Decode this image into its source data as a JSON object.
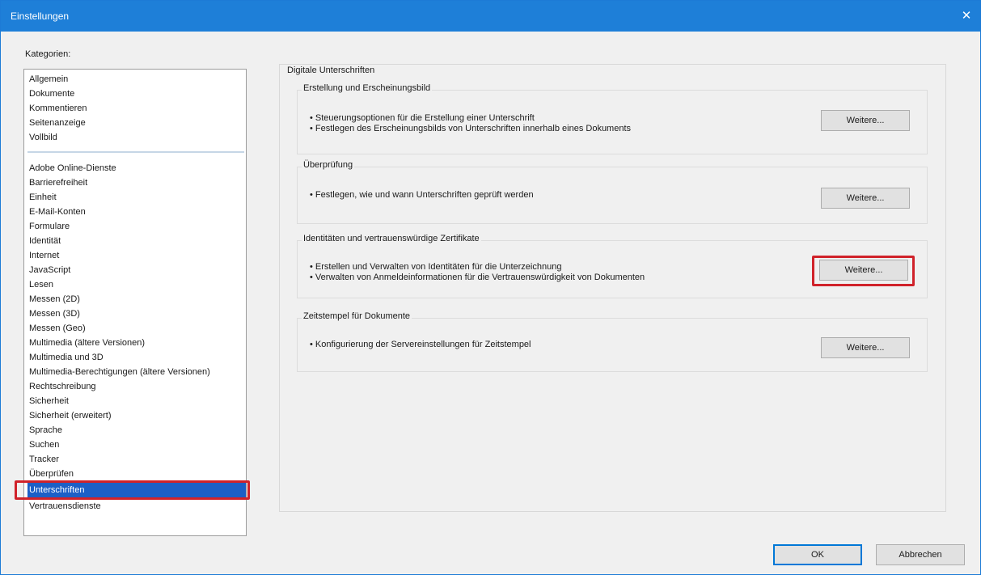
{
  "window": {
    "title": "Einstellungen",
    "close_glyph": "✕"
  },
  "categories": {
    "label": "Kategorien:",
    "group1": [
      "Allgemein",
      "Dokumente",
      "Kommentieren",
      "Seitenanzeige",
      "Vollbild"
    ],
    "group2": [
      "Adobe Online-Dienste",
      "Barrierefreiheit",
      "Einheit",
      "E-Mail-Konten",
      "Formulare",
      "Identität",
      "Internet",
      "JavaScript",
      "Lesen",
      "Messen (2D)",
      "Messen (3D)",
      "Messen (Geo)",
      "Multimedia (ältere Versionen)",
      "Multimedia und 3D",
      "Multimedia-Berechtigungen (ältere Versionen)",
      "Rechtschreibung",
      "Sicherheit",
      "Sicherheit (erweitert)",
      "Sprache",
      "Suchen",
      "Tracker",
      "Überprüfen",
      "Unterschriften",
      "Vertrauensdienste"
    ],
    "selected": "Unterschriften"
  },
  "main": {
    "title": "Digitale Unterschriften",
    "sections": [
      {
        "title": "Erstellung und Erscheinungsbild",
        "bullets": [
          "• Steuerungsoptionen für die Erstellung einer Unterschrift",
          "• Festlegen des Erscheinungsbilds von Unterschriften innerhalb eines Dokuments"
        ],
        "button": "Weitere..."
      },
      {
        "title": "Überprüfung",
        "bullets": [
          "• Festlegen, wie und wann Unterschriften geprüft werden"
        ],
        "button": "Weitere..."
      },
      {
        "title": "Identitäten und vertrauenswürdige Zertifikate",
        "bullets": [
          "• Erstellen und Verwalten von Identitäten für die Unterzeichnung",
          "• Verwalten von Anmeldeinformationen für die Vertrauenswürdigkeit von Dokumenten"
        ],
        "button": "Weitere..."
      },
      {
        "title": "Zeitstempel für Dokumente",
        "bullets": [
          "• Konfigurierung der Servereinstellungen für Zeitstempel"
        ],
        "button": "Weitere..."
      }
    ]
  },
  "footer": {
    "ok_label": "OK",
    "cancel_label": "Abbrechen"
  },
  "colors": {
    "titlebar": "#1e7fd8",
    "selection": "#1c5fc6",
    "highlight_frame": "#d0222a"
  }
}
